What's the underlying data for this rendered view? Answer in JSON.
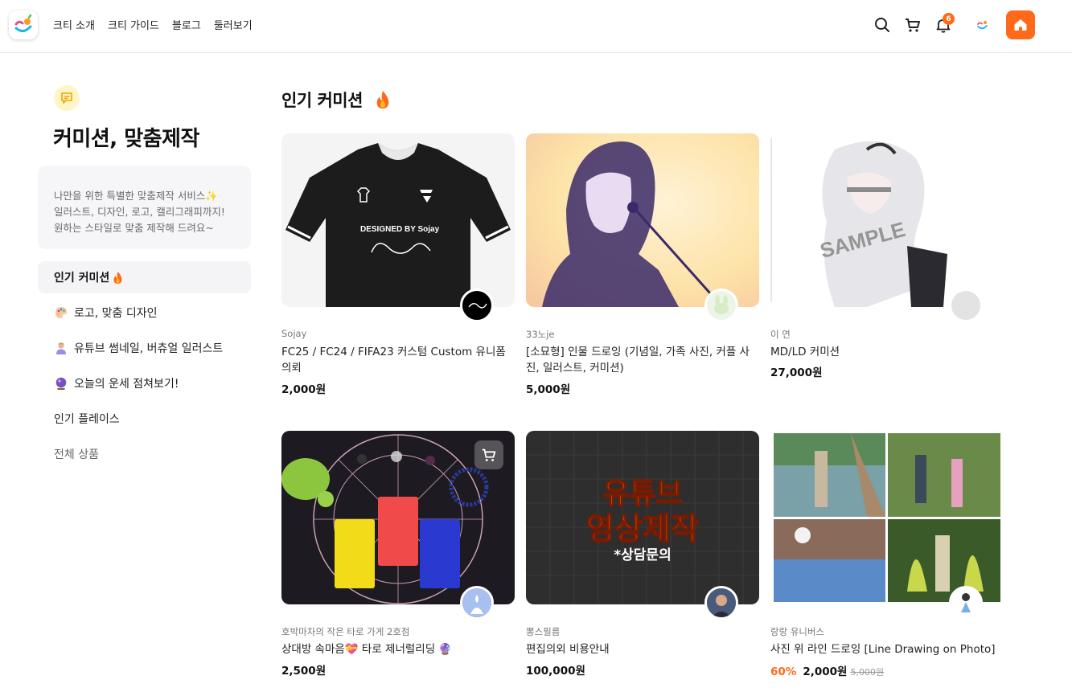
{
  "header": {
    "nav": [
      "크티 소개",
      "크티 가이드",
      "블로그",
      "둘러보기"
    ],
    "notification_count": "6"
  },
  "sidebar": {
    "title": "커미션, 맞춤제작",
    "description": [
      "나만을 위한 특별한 맞춤제작 서비스✨",
      "일러스트, 디자인, 로고, 캘리그래피까지!",
      "원하는 스타일로 맞춤 제작해 드려요~"
    ],
    "items": [
      {
        "label": "인기 커미션"
      },
      {
        "label": "로고, 맞춤 디자인"
      },
      {
        "label": "유튜브 썸네일, 버츄얼 일러스트"
      },
      {
        "label": "오늘의 운세 점쳐보기!"
      },
      {
        "label": "인기 플레이스"
      },
      {
        "label": "전체 상품"
      }
    ]
  },
  "main": {
    "section_title": "인기 커미션",
    "products": [
      {
        "seller": "Sojay",
        "title": "FC25 / FC24 / FIFA23 커스텀 Custom 유니폼 의뢰",
        "price": "2,000원",
        "thumb_text": "DESIGNED BY Sojay"
      },
      {
        "seller": "33노je",
        "title": "[소묘형] 인물 드로잉 (기념일, 가족 사진, 커플 사진, 일러스트, 커미션)",
        "price": "5,000원"
      },
      {
        "seller": "이 연",
        "title": "MD/LD 커미션",
        "price": "27,000원",
        "thumb_text": "SAMPLE"
      },
      {
        "seller": "호박마차의 작은 타로 가게 2호점",
        "title": "상대방 속마음💝 타로 제너럴리딩 🔮",
        "price": "2,500원"
      },
      {
        "seller": "뽕스필름",
        "title": "편집의외 비용안내",
        "price": "100,000원",
        "thumb_text": [
          "유튜브",
          "영상제작",
          "*상담문의"
        ]
      },
      {
        "seller": "랑랑 유니버스",
        "title": "사진 위 라인 드로잉 [Line Drawing on Photo]",
        "price": "2,000원",
        "discount": "60%",
        "original_price": "5,000원"
      }
    ]
  },
  "colors": {
    "accent": "#ff6a1a",
    "panel": "#f6f6f8"
  }
}
